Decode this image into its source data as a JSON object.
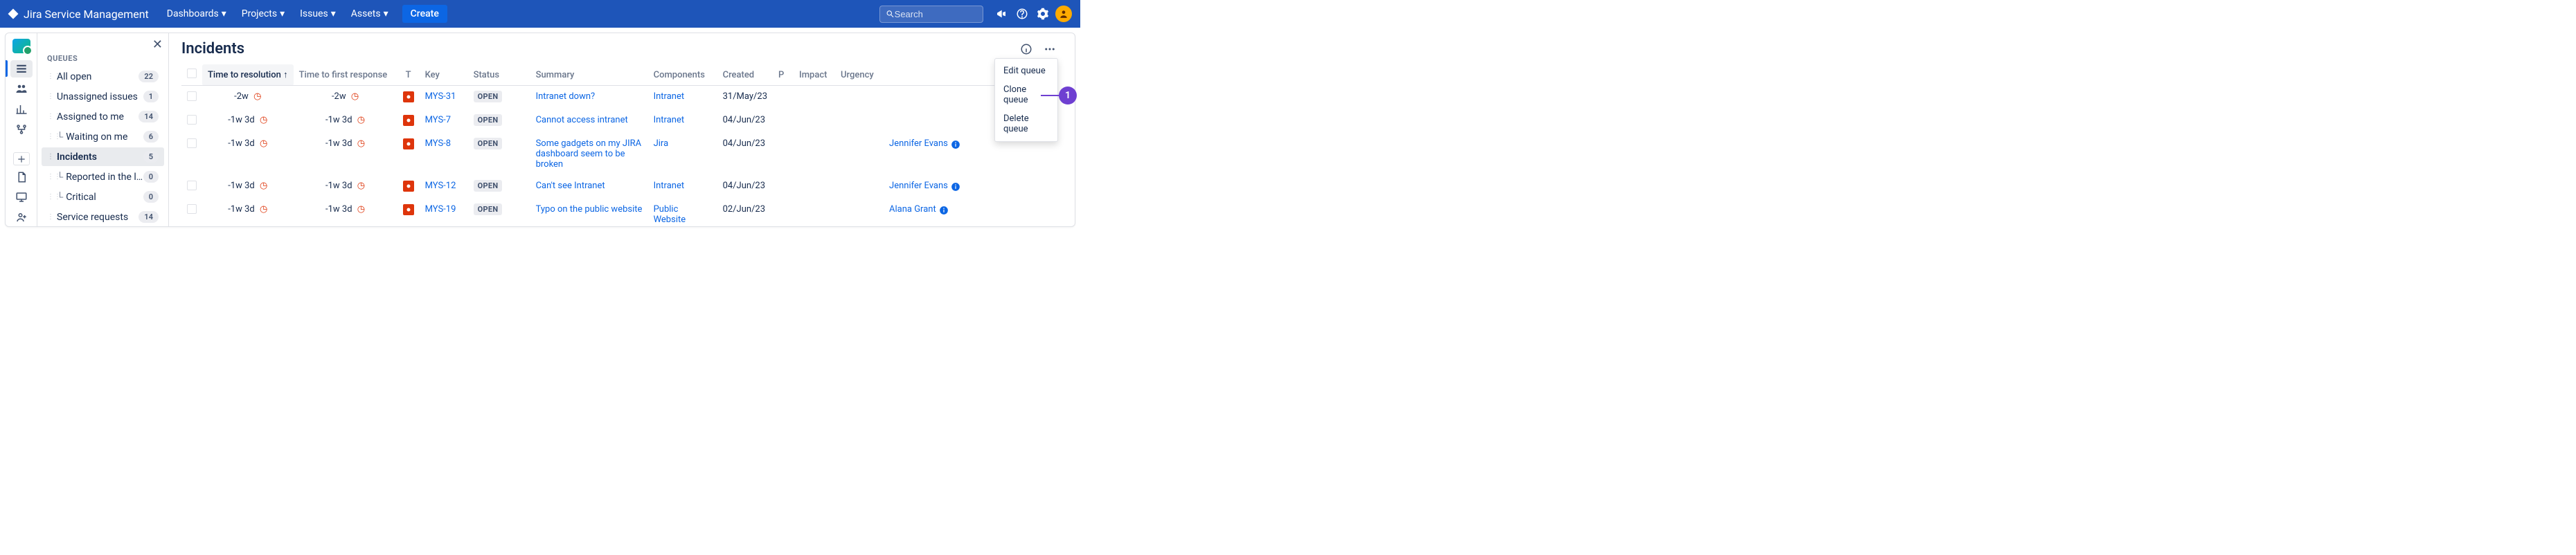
{
  "topnav": {
    "product": "Jira Service Management",
    "menu": [
      "Dashboards",
      "Projects",
      "Issues",
      "Assets"
    ],
    "create": "Create",
    "search_placeholder": "Search"
  },
  "sidebar": {
    "section": "QUEUES",
    "items": [
      {
        "label": "All open",
        "count": "22",
        "sub": false
      },
      {
        "label": "Unassigned issues",
        "count": "1",
        "sub": false
      },
      {
        "label": "Assigned to me",
        "count": "14",
        "sub": false
      },
      {
        "label": "Waiting on me",
        "count": "6",
        "sub": true
      },
      {
        "label": "Incidents",
        "count": "5",
        "sub": false,
        "active": true
      },
      {
        "label": "Reported in the l...",
        "count": "0",
        "sub": true
      },
      {
        "label": "Critical",
        "count": "0",
        "sub": true
      },
      {
        "label": "Service requests",
        "count": "14",
        "sub": false
      }
    ]
  },
  "main": {
    "title": "Incidents",
    "columns": {
      "time_to_resolution": "Time to resolution",
      "time_to_first": "Time to first response",
      "t": "T",
      "key": "Key",
      "status": "Status",
      "summary": "Summary",
      "components": "Components",
      "created": "Created",
      "p": "P",
      "impact": "Impact",
      "urgency": "Urgency"
    },
    "rows": [
      {
        "ttr": "-2w",
        "ttf": "-2w",
        "key": "MYS-31",
        "status": "OPEN",
        "summary": "Intranet down?",
        "components": "Intranet",
        "created": "31/May/23",
        "assignee": ""
      },
      {
        "ttr": "-1w 3d",
        "ttf": "-1w 3d",
        "key": "MYS-7",
        "status": "OPEN",
        "summary": "Cannot access intranet",
        "components": "Intranet",
        "created": "04/Jun/23",
        "assignee": ""
      },
      {
        "ttr": "-1w 3d",
        "ttf": "-1w 3d",
        "key": "MYS-8",
        "status": "OPEN",
        "summary": "Some gadgets on my JIRA dashboard seem to be broken",
        "components": "Jira",
        "created": "04/Jun/23",
        "assignee": "Jennifer Evans"
      },
      {
        "ttr": "-1w 3d",
        "ttf": "-1w 3d",
        "key": "MYS-12",
        "status": "OPEN",
        "summary": "Can't see Intranet",
        "components": "Intranet",
        "created": "04/Jun/23",
        "assignee": "Jennifer Evans"
      },
      {
        "ttr": "-1w 3d",
        "ttf": "-1w 3d",
        "key": "MYS-19",
        "status": "OPEN",
        "summary": "Typo on the public website",
        "components": "Public Website",
        "created": "02/Jun/23",
        "assignee": "Alana Grant"
      }
    ]
  },
  "context_menu": {
    "edit": "Edit queue",
    "clone": "Clone queue",
    "delete": "Delete queue"
  },
  "callout": {
    "num": "1"
  }
}
